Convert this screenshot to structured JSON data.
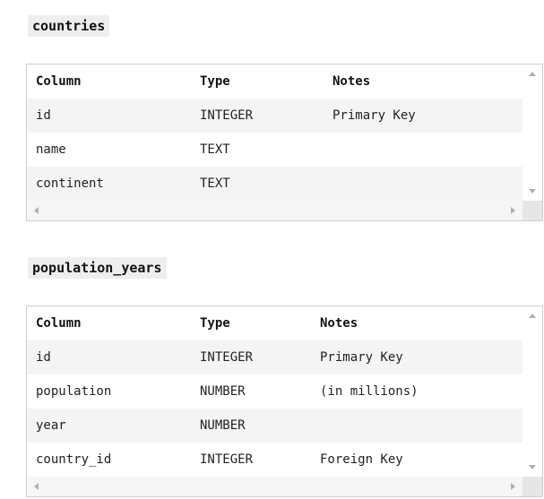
{
  "tables": [
    {
      "name": "countries",
      "headers": [
        "Column",
        "Type",
        "Notes"
      ],
      "rows": [
        [
          "id",
          "INTEGER",
          "Primary Key"
        ],
        [
          "name",
          "TEXT",
          ""
        ],
        [
          "continent",
          "TEXT",
          ""
        ]
      ]
    },
    {
      "name": "population_years",
      "headers": [
        "Column",
        "Type",
        "Notes"
      ],
      "rows": [
        [
          "id",
          "INTEGER",
          "Primary Key"
        ],
        [
          "population",
          "NUMBER",
          "(in millions)"
        ],
        [
          "year",
          "NUMBER",
          ""
        ],
        [
          "country_id",
          "INTEGER",
          "Foreign Key"
        ]
      ]
    }
  ]
}
